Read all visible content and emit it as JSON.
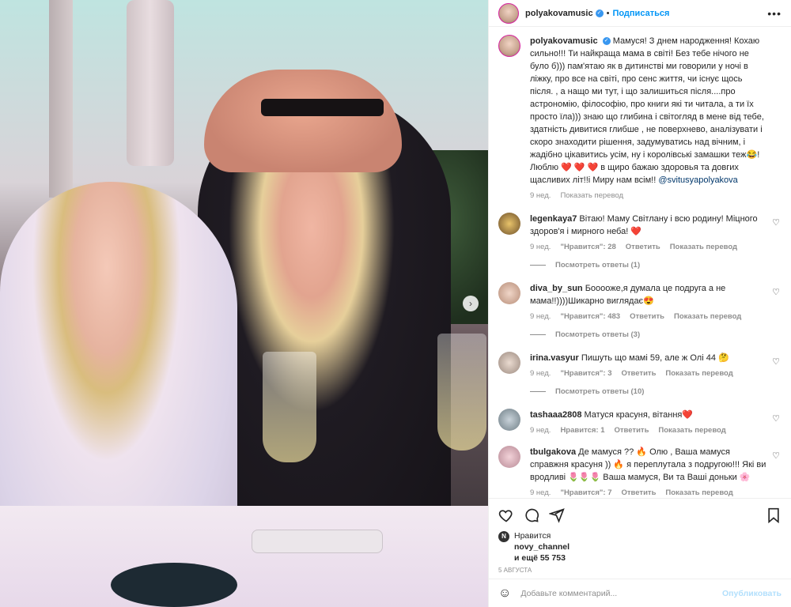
{
  "post": {
    "author": "polyakovamusic",
    "follow_label": "Подписаться",
    "more_label": "•••",
    "caption": {
      "username": "polyakovamusic",
      "text": "Мамуся! З днем народження! Кохаю сильно!!! Ти найкраща мама в світі! Без тебе нічого не було б))) пам'ятаю як в дитинстві ми говорили у ночі в ліжку, про все на світі, про сенс життя, чи існує щось після. , а нащо ми тут, і що залишиться після....про астрономію, філософію, про книги які ти читала, а ти їх просто їла))) знаю що глибина і світогляд в мене від тебе, здатність дивитися глибше , не поверхнево, аналізувати і скоро знаходити рішення, задумуватись над вічним, і жадібно цікавитись усім, ну і королівські замашки теж😂! Люблю ❤️ ❤️ ❤️ в щиро бажаю здоровья та довгих щасливих літ!!і Миру нам всім!!",
      "mention": "@svitusyapolyakova",
      "time": "9 нед.",
      "translate": "Показать перевод"
    }
  },
  "comments": [
    {
      "username": "legenkaya7",
      "text": "Вітаю! Маму Світлану і всю родину! Міцного здоров'я і мирного неба! ❤️",
      "time": "9 нед.",
      "likes": "\"Нравится\": 28",
      "reply": "Ответить",
      "translate": "Показать перевод",
      "replies": "Посмотреть ответы (1)"
    },
    {
      "username": "diva_by_sun",
      "text": "Бооооже,я думала це подруга а не мама!!))))Шикарно виглядає😍",
      "time": "9 нед.",
      "likes": "\"Нравится\": 483",
      "reply": "Ответить",
      "translate": "Показать перевод",
      "replies": "Посмотреть ответы (3)"
    },
    {
      "username": "irina.vasyur",
      "text": "Пишуть що мамі 59, але ж Олі 44 🤔",
      "time": "9 нед.",
      "likes": "\"Нравится\": 3",
      "reply": "Ответить",
      "translate": "Показать перевод",
      "replies": "Посмотреть ответы (10)"
    },
    {
      "username": "tashaaa2808",
      "text": "Матуся красуня, вітання❤️",
      "time": "9 нед.",
      "likes": "Нравится: 1",
      "reply": "Ответить",
      "translate": "Показать перевод",
      "replies": ""
    },
    {
      "username": "tbulgakova",
      "text": "Де мамуся ?? 🔥 Олю , Ваша мамуся справжня красуня )) 🔥 я переплутала з подругою!!! Які ви вродливі 🌷🌷🌷 Ваша мамуся, Ви та Ваші доньки 🌸",
      "time": "9 нед.",
      "likes": "\"Нравится\": 7",
      "reply": "Ответить",
      "translate": "Показать перевод",
      "replies": ""
    }
  ],
  "likes": {
    "mini_initial": "N",
    "label": "Нравится",
    "user": "novy_channel",
    "rest": "и ещё 55 753"
  },
  "date": "5 августа",
  "add_comment": {
    "placeholder": "Добавьте комментарий...",
    "publish": "Опубликовать"
  },
  "icons": [
    "heart-icon",
    "comment-icon",
    "share-icon",
    "bookmark-icon",
    "emoji-icon",
    "more-icon",
    "chevron-right-icon",
    "verified-icon"
  ]
}
